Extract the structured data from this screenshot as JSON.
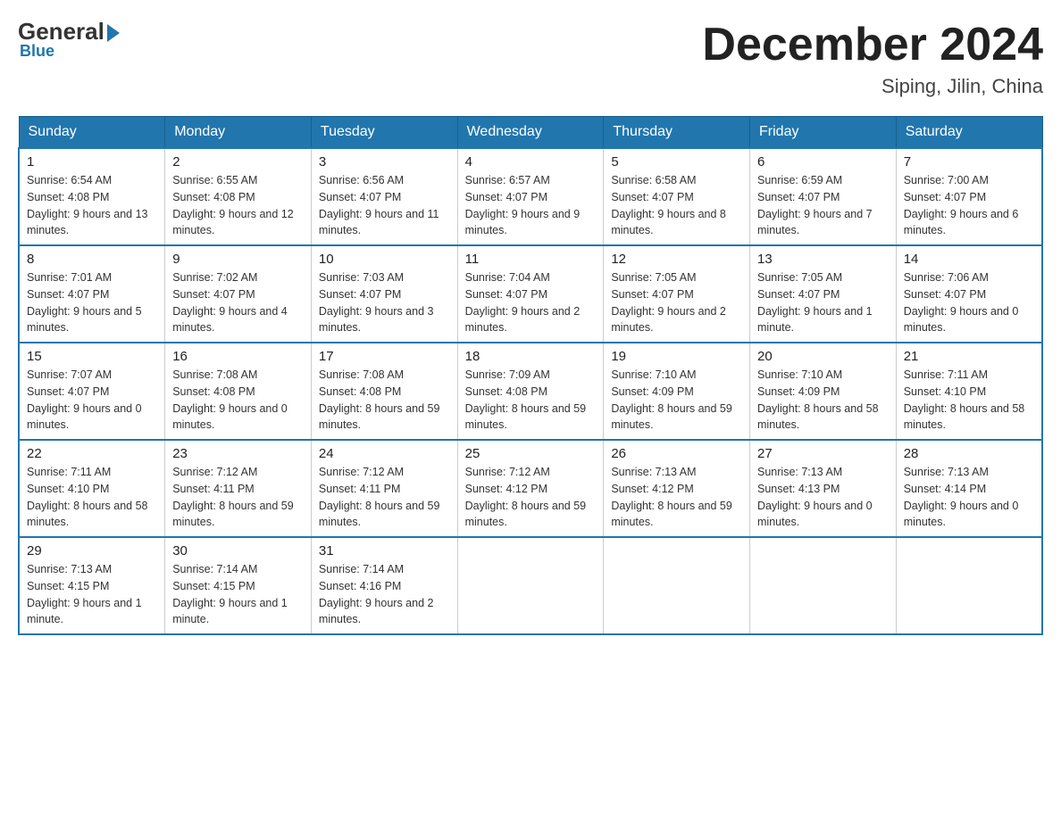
{
  "header": {
    "logo_general": "General",
    "logo_blue": "Blue",
    "month_title": "December 2024",
    "location": "Siping, Jilin, China"
  },
  "days_of_week": [
    "Sunday",
    "Monday",
    "Tuesday",
    "Wednesday",
    "Thursday",
    "Friday",
    "Saturday"
  ],
  "weeks": [
    [
      {
        "day": "1",
        "sunrise": "6:54 AM",
        "sunset": "4:08 PM",
        "daylight": "9 hours and 13 minutes."
      },
      {
        "day": "2",
        "sunrise": "6:55 AM",
        "sunset": "4:08 PM",
        "daylight": "9 hours and 12 minutes."
      },
      {
        "day": "3",
        "sunrise": "6:56 AM",
        "sunset": "4:07 PM",
        "daylight": "9 hours and 11 minutes."
      },
      {
        "day": "4",
        "sunrise": "6:57 AM",
        "sunset": "4:07 PM",
        "daylight": "9 hours and 9 minutes."
      },
      {
        "day": "5",
        "sunrise": "6:58 AM",
        "sunset": "4:07 PM",
        "daylight": "9 hours and 8 minutes."
      },
      {
        "day": "6",
        "sunrise": "6:59 AM",
        "sunset": "4:07 PM",
        "daylight": "9 hours and 7 minutes."
      },
      {
        "day": "7",
        "sunrise": "7:00 AM",
        "sunset": "4:07 PM",
        "daylight": "9 hours and 6 minutes."
      }
    ],
    [
      {
        "day": "8",
        "sunrise": "7:01 AM",
        "sunset": "4:07 PM",
        "daylight": "9 hours and 5 minutes."
      },
      {
        "day": "9",
        "sunrise": "7:02 AM",
        "sunset": "4:07 PM",
        "daylight": "9 hours and 4 minutes."
      },
      {
        "day": "10",
        "sunrise": "7:03 AM",
        "sunset": "4:07 PM",
        "daylight": "9 hours and 3 minutes."
      },
      {
        "day": "11",
        "sunrise": "7:04 AM",
        "sunset": "4:07 PM",
        "daylight": "9 hours and 2 minutes."
      },
      {
        "day": "12",
        "sunrise": "7:05 AM",
        "sunset": "4:07 PM",
        "daylight": "9 hours and 2 minutes."
      },
      {
        "day": "13",
        "sunrise": "7:05 AM",
        "sunset": "4:07 PM",
        "daylight": "9 hours and 1 minute."
      },
      {
        "day": "14",
        "sunrise": "7:06 AM",
        "sunset": "4:07 PM",
        "daylight": "9 hours and 0 minutes."
      }
    ],
    [
      {
        "day": "15",
        "sunrise": "7:07 AM",
        "sunset": "4:07 PM",
        "daylight": "9 hours and 0 minutes."
      },
      {
        "day": "16",
        "sunrise": "7:08 AM",
        "sunset": "4:08 PM",
        "daylight": "9 hours and 0 minutes."
      },
      {
        "day": "17",
        "sunrise": "7:08 AM",
        "sunset": "4:08 PM",
        "daylight": "8 hours and 59 minutes."
      },
      {
        "day": "18",
        "sunrise": "7:09 AM",
        "sunset": "4:08 PM",
        "daylight": "8 hours and 59 minutes."
      },
      {
        "day": "19",
        "sunrise": "7:10 AM",
        "sunset": "4:09 PM",
        "daylight": "8 hours and 59 minutes."
      },
      {
        "day": "20",
        "sunrise": "7:10 AM",
        "sunset": "4:09 PM",
        "daylight": "8 hours and 58 minutes."
      },
      {
        "day": "21",
        "sunrise": "7:11 AM",
        "sunset": "4:10 PM",
        "daylight": "8 hours and 58 minutes."
      }
    ],
    [
      {
        "day": "22",
        "sunrise": "7:11 AM",
        "sunset": "4:10 PM",
        "daylight": "8 hours and 58 minutes."
      },
      {
        "day": "23",
        "sunrise": "7:12 AM",
        "sunset": "4:11 PM",
        "daylight": "8 hours and 59 minutes."
      },
      {
        "day": "24",
        "sunrise": "7:12 AM",
        "sunset": "4:11 PM",
        "daylight": "8 hours and 59 minutes."
      },
      {
        "day": "25",
        "sunrise": "7:12 AM",
        "sunset": "4:12 PM",
        "daylight": "8 hours and 59 minutes."
      },
      {
        "day": "26",
        "sunrise": "7:13 AM",
        "sunset": "4:12 PM",
        "daylight": "8 hours and 59 minutes."
      },
      {
        "day": "27",
        "sunrise": "7:13 AM",
        "sunset": "4:13 PM",
        "daylight": "9 hours and 0 minutes."
      },
      {
        "day": "28",
        "sunrise": "7:13 AM",
        "sunset": "4:14 PM",
        "daylight": "9 hours and 0 minutes."
      }
    ],
    [
      {
        "day": "29",
        "sunrise": "7:13 AM",
        "sunset": "4:15 PM",
        "daylight": "9 hours and 1 minute."
      },
      {
        "day": "30",
        "sunrise": "7:14 AM",
        "sunset": "4:15 PM",
        "daylight": "9 hours and 1 minute."
      },
      {
        "day": "31",
        "sunrise": "7:14 AM",
        "sunset": "4:16 PM",
        "daylight": "9 hours and 2 minutes."
      },
      null,
      null,
      null,
      null
    ]
  ]
}
